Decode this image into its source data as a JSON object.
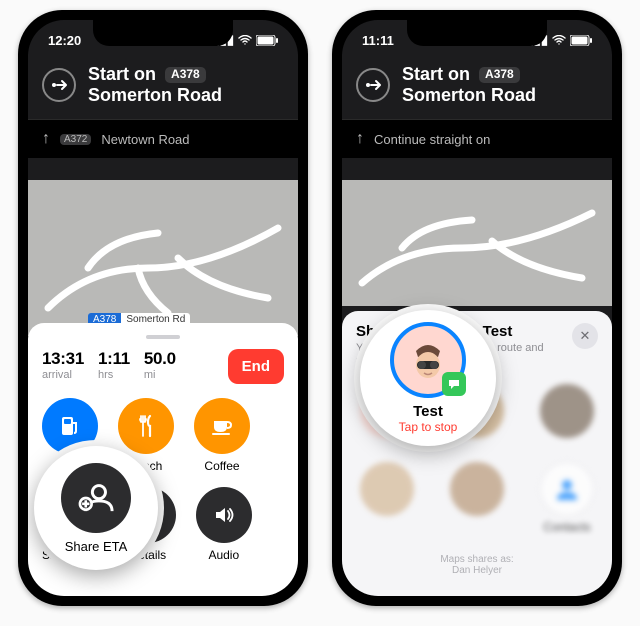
{
  "left": {
    "status_time": "12:20",
    "instruction": {
      "prefix": "Start on",
      "road_code": "A378",
      "road_name": "Somerton Road"
    },
    "next_step": {
      "road_code": "A372",
      "road_name": "Newtown Road"
    },
    "map_label": {
      "code": "A378",
      "name": "Somerton Rd"
    },
    "stats": {
      "arrival_value": "13:31",
      "arrival_label": "arrival",
      "duration_value": "1:11",
      "duration_label": "hrs",
      "distance_value": "50.0",
      "distance_label": "mi"
    },
    "end_label": "End",
    "categories": [
      {
        "label": "Petrol",
        "icon": "fuel-icon"
      },
      {
        "label": "Lunch",
        "icon": "cutlery-icon"
      },
      {
        "label": "Coffee",
        "icon": "coffee-icon"
      }
    ],
    "bottom": [
      {
        "label": "Share ETA",
        "icon": "share-eta-icon"
      },
      {
        "label": "Details",
        "icon": "details-icon"
      },
      {
        "label": "Audio",
        "icon": "audio-icon"
      }
    ]
  },
  "right": {
    "status_time": "11:11",
    "instruction": {
      "prefix": "Start on",
      "road_code": "A378",
      "road_name": "Somerton Road"
    },
    "next_step_text": "Continue straight on",
    "sheet": {
      "title": "Sharing ETA with Test",
      "subtitle": "You're sharing your location, route and destination until you arrive",
      "contact_name": "Test",
      "tap_to_stop": "Tap to stop",
      "contacts_label": "Contacts",
      "footer_line1": "Maps shares as:",
      "footer_line2": "Dan Helyer"
    }
  }
}
